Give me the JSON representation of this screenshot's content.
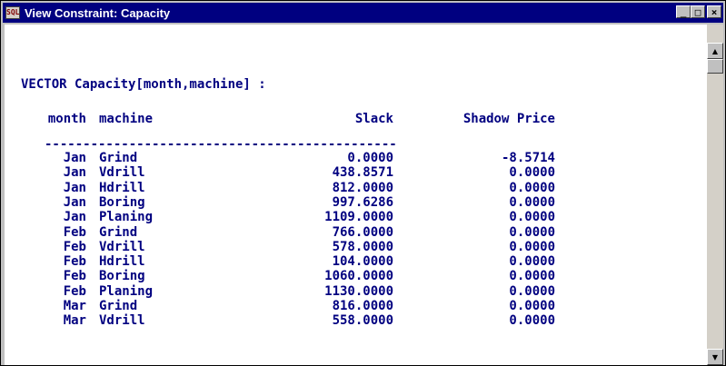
{
  "window": {
    "title": "View Constraint: Capacity",
    "icon": "sql-app-icon",
    "buttons": {
      "minimize": "_",
      "maximize": "□",
      "close": "×"
    }
  },
  "heading": "VECTOR Capacity[month,machine] :",
  "columns": {
    "month": "month",
    "machine": "machine",
    "slack": "Slack",
    "shadow": "Shadow Price"
  },
  "separator": "----------------------------------------------",
  "rows": [
    {
      "month": "Jan",
      "machine": "Grind",
      "slack": "0.0000",
      "shadow": "-8.5714"
    },
    {
      "month": "Jan",
      "machine": "Vdrill",
      "slack": "438.8571",
      "shadow": "0.0000"
    },
    {
      "month": "Jan",
      "machine": "Hdrill",
      "slack": "812.0000",
      "shadow": "0.0000"
    },
    {
      "month": "Jan",
      "machine": "Boring",
      "slack": "997.6286",
      "shadow": "0.0000"
    },
    {
      "month": "Jan",
      "machine": "Planing",
      "slack": "1109.0000",
      "shadow": "0.0000"
    },
    {
      "month": "Feb",
      "machine": "Grind",
      "slack": "766.0000",
      "shadow": "0.0000"
    },
    {
      "month": "Feb",
      "machine": "Vdrill",
      "slack": "578.0000",
      "shadow": "0.0000"
    },
    {
      "month": "Feb",
      "machine": "Hdrill",
      "slack": "104.0000",
      "shadow": "0.0000"
    },
    {
      "month": "Feb",
      "machine": "Boring",
      "slack": "1060.0000",
      "shadow": "0.0000"
    },
    {
      "month": "Feb",
      "machine": "Planing",
      "slack": "1130.0000",
      "shadow": "0.0000"
    },
    {
      "month": "Mar",
      "machine": "Grind",
      "slack": "816.0000",
      "shadow": "0.0000"
    },
    {
      "month": "Mar",
      "machine": "Vdrill",
      "slack": "558.0000",
      "shadow": "0.0000"
    }
  ],
  "colors": {
    "titlebar": "#000080",
    "text": "#000080",
    "background": "#ffffff",
    "chrome": "#c0c0c0"
  }
}
